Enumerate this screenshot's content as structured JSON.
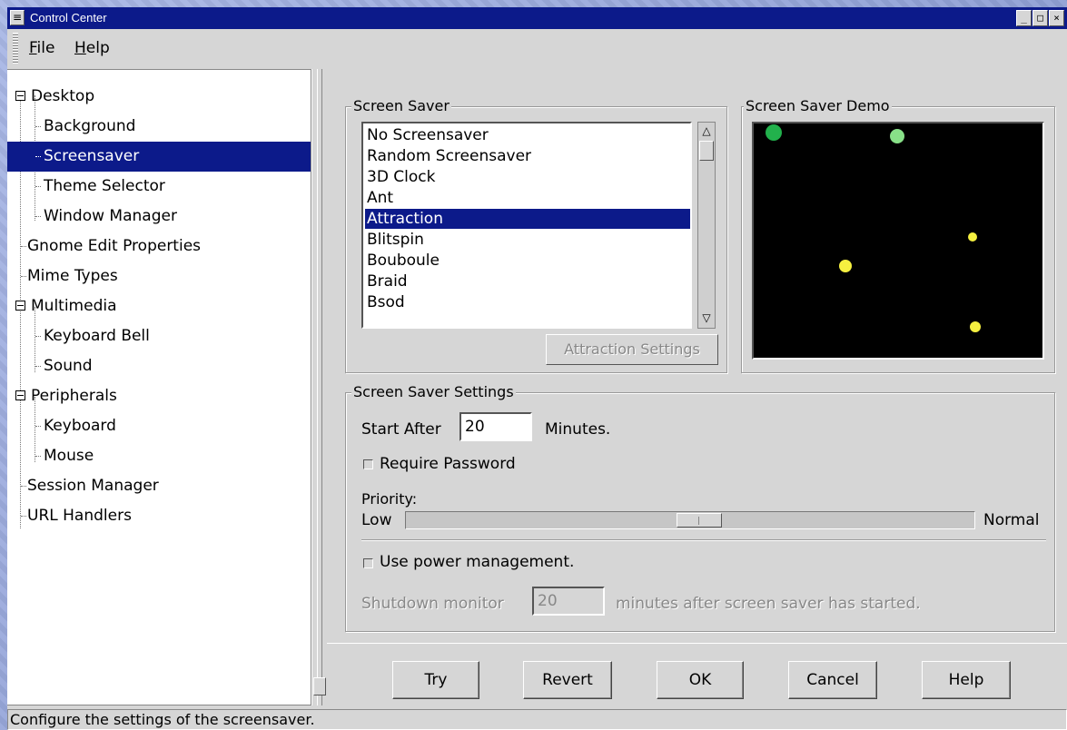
{
  "window": {
    "title": "Control Center"
  },
  "titlebar_buttons": {
    "minimize": "_",
    "maximize": "□",
    "close": "×"
  },
  "menu": [
    {
      "label": "File",
      "mnemonic": "F",
      "rest": "ile"
    },
    {
      "label": "Help",
      "mnemonic": "H",
      "rest": "elp"
    }
  ],
  "tree": [
    {
      "label": "Desktop",
      "level": 0,
      "expandable": true
    },
    {
      "label": "Background",
      "level": 1
    },
    {
      "label": "Screensaver",
      "level": 1,
      "selected": true
    },
    {
      "label": "Theme Selector",
      "level": 1
    },
    {
      "label": "Window Manager",
      "level": 1
    },
    {
      "label": "Gnome Edit Properties",
      "level": 0
    },
    {
      "label": "Mime Types",
      "level": 0
    },
    {
      "label": "Multimedia",
      "level": 0,
      "expandable": true
    },
    {
      "label": "Keyboard Bell",
      "level": 1
    },
    {
      "label": "Sound",
      "level": 1
    },
    {
      "label": "Peripherals",
      "level": 0,
      "expandable": true
    },
    {
      "label": "Keyboard",
      "level": 1
    },
    {
      "label": "Mouse",
      "level": 1
    },
    {
      "label": "Session Manager",
      "level": 0
    },
    {
      "label": "URL Handlers",
      "level": 0
    }
  ],
  "screensaver": {
    "frame_title": "Screen Saver",
    "items": [
      "No Screensaver",
      "Random Screensaver",
      "3D Clock",
      "Ant",
      "Attraction",
      "Blitspin",
      "Bouboule",
      "Braid",
      "Bsod"
    ],
    "selected": "Attraction",
    "settings_button": "Attraction Settings"
  },
  "demo": {
    "frame_title": "Screen Saver Demo"
  },
  "settings": {
    "frame_title": "Screen Saver Settings",
    "start_after_label": "Start After",
    "start_after_value": "20",
    "minutes_label": "Minutes.",
    "require_password_label": "Require Password",
    "require_password_checked": false,
    "priority_label": "Priority:",
    "priority_low": "Low",
    "priority_high": "Normal",
    "use_power_label": "Use power management.",
    "use_power_checked": false,
    "shutdown_label": "Shutdown monitor",
    "shutdown_value": "20",
    "shutdown_suffix": "minutes after screen saver has started."
  },
  "buttons": {
    "try": "Try",
    "revert": "Revert",
    "ok": "OK",
    "cancel": "Cancel",
    "help": "Help"
  },
  "status": "Configure the settings of the screensaver.",
  "colors": {
    "selection": "#0c1a8a",
    "demo_background": "#000000",
    "dot_green": "#22b14c",
    "dot_light_green": "#88e088",
    "dot_yellow": "#f5f040"
  }
}
